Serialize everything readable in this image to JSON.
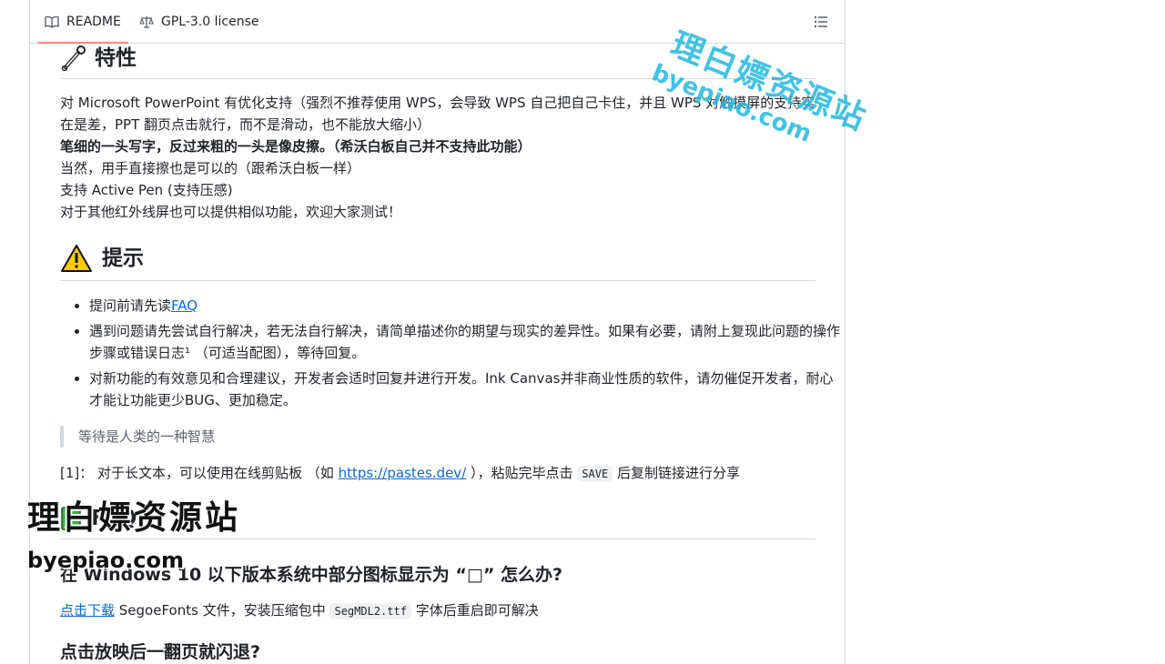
{
  "tabs": {
    "readme_label": "README",
    "license_label": "GPL-3.0 license"
  },
  "features": {
    "title": "特性",
    "line1": "对 Microsoft PowerPoint 有优化支持（强烈不推荐使用 WPS，会导致 WPS 自己把自己卡住，并且 WPS 对触摸屏的支持实在是差，PPT 翻页点击就行，而不是滑动，也不能放大缩小）",
    "line2": "笔细的一头写字，反过来粗的一头是像皮擦。（希沃白板自己并不支持此功能）",
    "line3": "当然，用手直接擦也是可以的（跟希沃白板一样）",
    "line4": "支持 Active Pen (支持压感)",
    "line5": "对于其他红外线屏也可以提供相似功能，欢迎大家测试！"
  },
  "tips": {
    "title": "提示",
    "item1_prefix": "提问前请先读",
    "item1_link": "FAQ",
    "item2": "遇到问题请先尝试自行解决，若无法自行解决，请简单描述你的期望与现实的差异性。如果有必要，请附上复现此问题的操作步骤或错误日志¹ （可适当配图），等待回复。",
    "item3": "对新功能的有效意见和合理建议，开发者会适时回复并进行开发。Ink Canvas并非商业性质的软件，请勿催促开发者，耐心才能让功能更少BUG、更加稳定。",
    "quote": "等待是人类的一种智慧",
    "note_prefix": "[1]： 对于长文本，可以使用在线剪贴板 （如 ",
    "note_link": "https://pastes.dev/",
    "note_mid": " ），粘贴完毕点击 ",
    "note_code": "SAVE",
    "note_suffix": " 后复制链接进行分享"
  },
  "faq": {
    "title": "FAQ",
    "q1": "在 Windows 10 以下版本系统中部分图标显示为 “□” 怎么办?",
    "a1_link": "点击下载",
    "a1_mid": " SegoeFonts 文件，安装压缩包中 ",
    "a1_code": "SegMDL2.ttf",
    "a1_suffix": " 字体后重启即可解决",
    "q2": "点击放映后一翻页就闪退?"
  },
  "watermark": {
    "cn": "理白嫖资源站",
    "en": "byepiao.com"
  },
  "colors": {
    "accent_underline": "#fd8c73",
    "link": "#0969da",
    "watermark_blue": "#22b8e0"
  }
}
